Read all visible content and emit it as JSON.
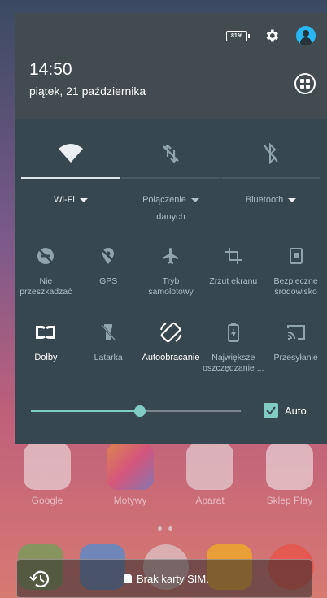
{
  "status": {
    "battery_level": "81%",
    "settings_icon": "gear-icon",
    "user_icon": "account-circle-icon"
  },
  "header": {
    "time": "14:50",
    "date": "piątek, 21 października",
    "edit_icon": "grid-icon"
  },
  "big_tiles": [
    {
      "label": "Wi-Fi",
      "icon": "wifi-icon",
      "active": true,
      "dropdown": true
    },
    {
      "label": "Połączenie",
      "label2": "danych",
      "icon": "mobile-data-off-icon",
      "active": false,
      "dropdown": true
    },
    {
      "label": "Bluetooth",
      "icon": "bluetooth-off-icon",
      "active": false,
      "dropdown": true
    }
  ],
  "tiles_row1": [
    {
      "label": "Nie",
      "label2": "przeszkadzać",
      "icon": "do-not-disturb-off-icon"
    },
    {
      "label": "GPS",
      "label2": "",
      "icon": "location-off-icon"
    },
    {
      "label": "Tryb",
      "label2": "samolotowy",
      "icon": "airplane-icon"
    },
    {
      "label": "Zrzut ekranu",
      "label2": "",
      "icon": "crop-icon"
    },
    {
      "label": "Bezpieczne",
      "label2": "środowisko",
      "icon": "secure-phone-icon"
    }
  ],
  "tiles_row2": [
    {
      "label": "Dolby",
      "label2": "",
      "icon": "dolby-icon",
      "active": true
    },
    {
      "label": "Latarka",
      "label2": "",
      "icon": "flashlight-off-icon",
      "active": false
    },
    {
      "label": "Autoobracanie",
      "label2": "",
      "icon": "auto-rotate-icon",
      "active": true
    },
    {
      "label": "Największe",
      "label2": "oszczędzanie ...",
      "icon": "battery-saver-icon",
      "active": false
    },
    {
      "label": "Przesyłanie",
      "label2": "",
      "icon": "cast-icon",
      "active": false
    }
  ],
  "brightness": {
    "level": 0.52,
    "auto_label": "Auto",
    "auto_checked": true
  },
  "home": {
    "apps": [
      {
        "label": "Google"
      },
      {
        "label": "Motywy"
      },
      {
        "label": "Aparat"
      },
      {
        "label": "Sklep Play"
      }
    ]
  },
  "toast": {
    "message": "Brak karty SIM."
  },
  "colors": {
    "shade_bg": "#37474f",
    "accent": "#80cbc4"
  }
}
